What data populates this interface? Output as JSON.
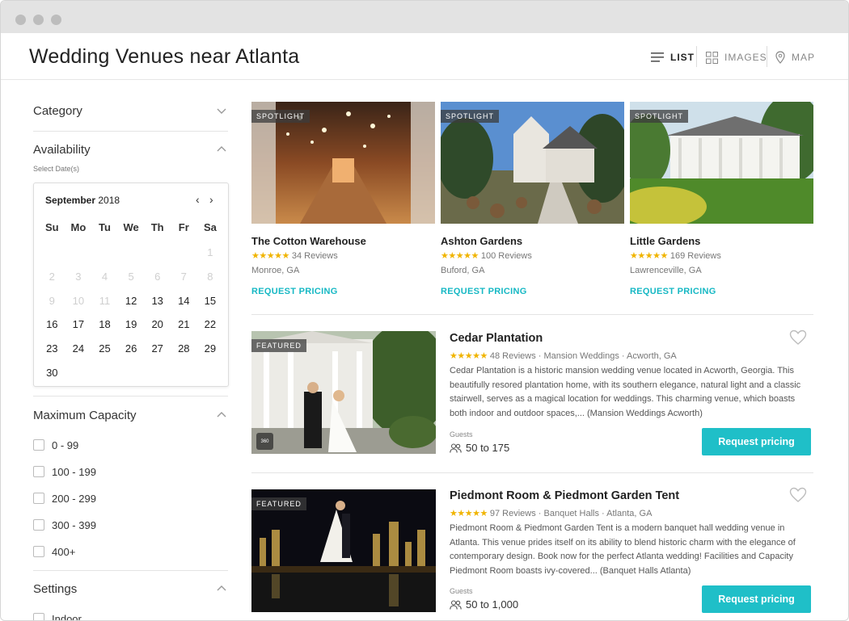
{
  "header": {
    "title": "Wedding Venues near Atlanta",
    "views": [
      {
        "label": "LIST",
        "icon": "list-icon",
        "active": true
      },
      {
        "label": "IMAGES",
        "icon": "grid-icon",
        "active": false
      },
      {
        "label": "MAP",
        "icon": "map-pin-icon",
        "active": false
      }
    ]
  },
  "sidebar": {
    "category": "Category",
    "availability": "Availability",
    "select_dates": "Select Date(s)",
    "calendar": {
      "month": "September",
      "year": "2018",
      "prev": "‹",
      "next": "›",
      "days_of_week": [
        "Su",
        "Mo",
        "Tu",
        "We",
        "Th",
        "Fr",
        "Sa"
      ],
      "rows": [
        [
          "",
          "",
          "",
          "",
          "",
          "",
          "1"
        ],
        [
          "2",
          "3",
          "4",
          "5",
          "6",
          "7",
          "8"
        ],
        [
          "9",
          "10",
          "11",
          "12",
          "13",
          "14",
          "15"
        ],
        [
          "16",
          "17",
          "18",
          "19",
          "20",
          "21",
          "22"
        ],
        [
          "23",
          "24",
          "25",
          "26",
          "27",
          "28",
          "29"
        ],
        [
          "30",
          "",
          "",
          "",
          "",
          "",
          ""
        ]
      ],
      "first_active_day": 12
    },
    "capacity": {
      "title": "Maximum Capacity",
      "options": [
        "0 - 99",
        "100 - 199",
        "200 - 299",
        "300 - 399",
        "400+"
      ]
    },
    "settings": {
      "title": "Settings",
      "options": [
        "Indoor"
      ]
    }
  },
  "spotlight": {
    "tag": "SPOTLIGHT",
    "cards": [
      {
        "name": "The Cotton Warehouse",
        "stars": "★★★★★",
        "reviews": "34 Reviews",
        "location": "Monroe, GA",
        "cta": "REQUEST PRICING"
      },
      {
        "name": "Ashton Gardens",
        "stars": "★★★★★",
        "reviews": "100 Reviews",
        "location": "Buford, GA",
        "cta": "REQUEST PRICING"
      },
      {
        "name": "Little Gardens",
        "stars": "★★★★★",
        "reviews": "169 Reviews",
        "location": "Lawrenceville, GA",
        "cta": "REQUEST PRICING"
      }
    ]
  },
  "featured": {
    "tag": "FEATURED",
    "listings": [
      {
        "name": "Cedar Plantation",
        "stars": "★★★★★",
        "meta": "48 Reviews · Mansion Weddings · Acworth, GA",
        "description": "Cedar Plantation is a historic mansion wedding venue located in Acworth, Georgia. This beautifully resored plantation home, with its southern elegance, natural light and a classic stairwell, serves as a magical location for weddings. This charming venue, which boasts both indoor and outdoor spaces,... (Mansion Weddings Acworth)",
        "guests_label": "Guests",
        "guests": "50 to 175",
        "cta": "Request pricing",
        "badge": "360"
      },
      {
        "name": "Piedmont Room & Piedmont Garden Tent",
        "stars": "★★★★★",
        "meta": "97 Reviews · Banquet Halls · Atlanta, GA",
        "description": "Piedmont Room & Piedmont Garden Tent is a modern banquet hall wedding venue in Atlanta. This venue prides itself on its ability to blend historic charm with the elegance of contemporary design. Book now for the perfect Atlanta wedding! Facilities and Capacity Piedmont Room boasts ivy-covered... (Banquet Halls Atlanta)",
        "guests_label": "Guests",
        "guests": "50 to 1,000",
        "cta": "Request pricing"
      }
    ]
  },
  "colors": {
    "accent": "#1fbfc8",
    "star": "#f0b400",
    "link": "#16b8c4"
  }
}
